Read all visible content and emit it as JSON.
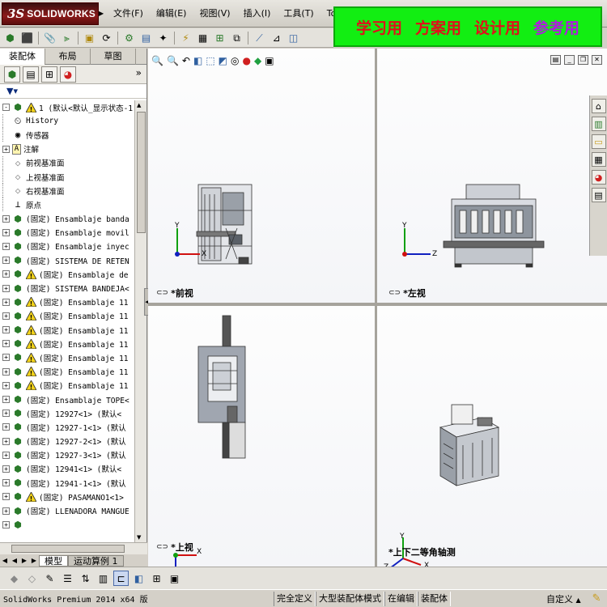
{
  "app": {
    "logo_prefix": "3S",
    "logo_name": "SOLIDWORKS"
  },
  "menu": [
    "文件(F)",
    "编辑(E)",
    "视图(V)",
    "插入(I)",
    "工具(T)",
    "Toolbox"
  ],
  "banner": {
    "text1": "学习用",
    "text2": "方案用",
    "text3": "设计用",
    "text4": "参考用",
    "color1": "#e0101a",
    "color4": "#b01ae0",
    "bg": "#12ee12"
  },
  "panel": {
    "tabs": [
      "装配体",
      "布局",
      "草图"
    ],
    "active_tab": "装配体",
    "expand_glyph": "»",
    "filter_glyph": "▼▾"
  },
  "tree": [
    {
      "text": "1 (默认<默认_显示状态-1",
      "expand": "-",
      "icon": "asm",
      "warn": true
    },
    {
      "text": "History",
      "expand": "",
      "icon": "history",
      "warn": false
    },
    {
      "text": "传感器",
      "expand": "",
      "icon": "sensor",
      "warn": false
    },
    {
      "text": "注解",
      "expand": "+",
      "icon": "annot",
      "warn": false
    },
    {
      "text": "前视基准面",
      "expand": "",
      "icon": "plane",
      "warn": false
    },
    {
      "text": "上视基准面",
      "expand": "",
      "icon": "plane",
      "warn": false
    },
    {
      "text": "右视基准面",
      "expand": "",
      "icon": "plane",
      "warn": false
    },
    {
      "text": "原点",
      "expand": "",
      "icon": "origin",
      "warn": false
    },
    {
      "text": "(固定) Ensamblaje banda",
      "expand": "+",
      "icon": "asm",
      "warn": false
    },
    {
      "text": "(固定) Ensamblaje movil",
      "expand": "+",
      "icon": "asm",
      "warn": false
    },
    {
      "text": "(固定) Ensamblaje inyec",
      "expand": "+",
      "icon": "asm",
      "warn": false
    },
    {
      "text": "(固定) SISTEMA DE RETEN",
      "expand": "+",
      "icon": "asm",
      "warn": false
    },
    {
      "text": "(固定) Ensamblaje de",
      "expand": "+",
      "icon": "asm",
      "warn": true
    },
    {
      "text": "(固定) SISTEMA BANDEJA<",
      "expand": "+",
      "icon": "asm",
      "warn": false
    },
    {
      "text": "(固定) Ensamblaje 11",
      "expand": "+",
      "icon": "asm",
      "warn": true
    },
    {
      "text": "(固定) Ensamblaje 11",
      "expand": "+",
      "icon": "asm",
      "warn": true
    },
    {
      "text": "(固定) Ensamblaje 11",
      "expand": "+",
      "icon": "asm",
      "warn": true
    },
    {
      "text": "(固定) Ensamblaje 11",
      "expand": "+",
      "icon": "asm",
      "warn": true
    },
    {
      "text": "(固定) Ensamblaje 11",
      "expand": "+",
      "icon": "asm",
      "warn": true
    },
    {
      "text": "(固定) Ensamblaje 11",
      "expand": "+",
      "icon": "asm",
      "warn": true
    },
    {
      "text": "(固定) Ensamblaje 11",
      "expand": "+",
      "icon": "asm",
      "warn": true
    },
    {
      "text": "(固定) Ensamblaje TOPE<",
      "expand": "+",
      "icon": "asm",
      "warn": false
    },
    {
      "text": "(固定) 12927<1> (默认<",
      "expand": "+",
      "icon": "asm",
      "warn": false
    },
    {
      "text": "(固定) 12927-1<1> (默认",
      "expand": "+",
      "icon": "asm",
      "warn": false
    },
    {
      "text": "(固定) 12927-2<1> (默认",
      "expand": "+",
      "icon": "asm",
      "warn": false
    },
    {
      "text": "(固定) 12927-3<1> (默认",
      "expand": "+",
      "icon": "asm",
      "warn": false
    },
    {
      "text": "(固定) 12941<1> (默认<",
      "expand": "+",
      "icon": "asm",
      "warn": false
    },
    {
      "text": "(固定) 12941-1<1> (默认",
      "expand": "+",
      "icon": "asm",
      "warn": false
    },
    {
      "text": "(固定) PASAMANO1<1>",
      "expand": "+",
      "icon": "asm",
      "warn": true
    },
    {
      "text": "(固定) LLENADORA MANGUE",
      "expand": "+",
      "icon": "asm",
      "warn": false
    },
    {
      "text": "",
      "expand": "+",
      "icon": "asm",
      "warn": false
    }
  ],
  "bottom_tabs": [
    "模型",
    "运动算例 1"
  ],
  "active_bottom_tab": "模型",
  "views": {
    "front": "*前视",
    "left": "*左视",
    "top": "*上视",
    "iso": "*上下二等角轴测"
  },
  "axes": {
    "x": "X",
    "y": "Y",
    "z": "Z"
  },
  "status": {
    "app": "SolidWorks Premium 2014 x64 版",
    "cells": [
      "完全定义",
      "大型装配体模式",
      "在编辑",
      "装配体"
    ],
    "custom": "自定义",
    "custom_arrow": "▲"
  },
  "colors": {
    "asm_green": "#2a7a2a",
    "warn_yellow": "#f2d21a",
    "axis_red": "#d01010",
    "axis_green": "#10a010",
    "axis_blue": "#1020c0"
  }
}
